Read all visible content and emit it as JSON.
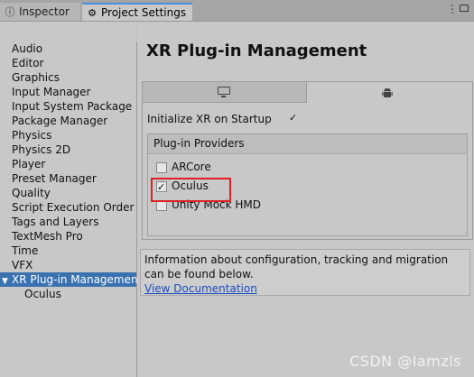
{
  "tabs": {
    "inspector": "Inspector",
    "project_settings": "Project Settings"
  },
  "icons": {
    "settings": "gear-icon",
    "standalone": "monitor-icon",
    "android": "android-icon"
  },
  "sidebar": {
    "items": [
      {
        "label": "Audio"
      },
      {
        "label": "Editor"
      },
      {
        "label": "Graphics"
      },
      {
        "label": "Input Manager"
      },
      {
        "label": "Input System Package"
      },
      {
        "label": "Package Manager"
      },
      {
        "label": "Physics"
      },
      {
        "label": "Physics 2D"
      },
      {
        "label": "Player"
      },
      {
        "label": "Preset Manager"
      },
      {
        "label": "Quality"
      },
      {
        "label": "Script Execution Order"
      },
      {
        "label": "Tags and Layers"
      },
      {
        "label": "TextMesh Pro"
      },
      {
        "label": "Time"
      },
      {
        "label": "VFX"
      },
      {
        "label": "XR Plug-in Management",
        "selected": true
      },
      {
        "label": "Oculus",
        "child": true
      }
    ]
  },
  "main": {
    "title": "XR Plug-in Management",
    "init_label": "Initialize XR on Startup",
    "init_checked": true,
    "providers_header": "Plug-in Providers",
    "providers": [
      {
        "label": "ARCore",
        "checked": false
      },
      {
        "label": "Oculus",
        "checked": true
      },
      {
        "label": "Unity Mock HMD",
        "checked": false
      }
    ],
    "info_text": "Information about configuration, tracking and migration can be found below.",
    "info_link": "View Documentation"
  },
  "watermark": "CSDN @Iamzls",
  "colors": {
    "selection": "#3a72b0",
    "highlight": "#e02020",
    "link": "#1a4cc0"
  }
}
